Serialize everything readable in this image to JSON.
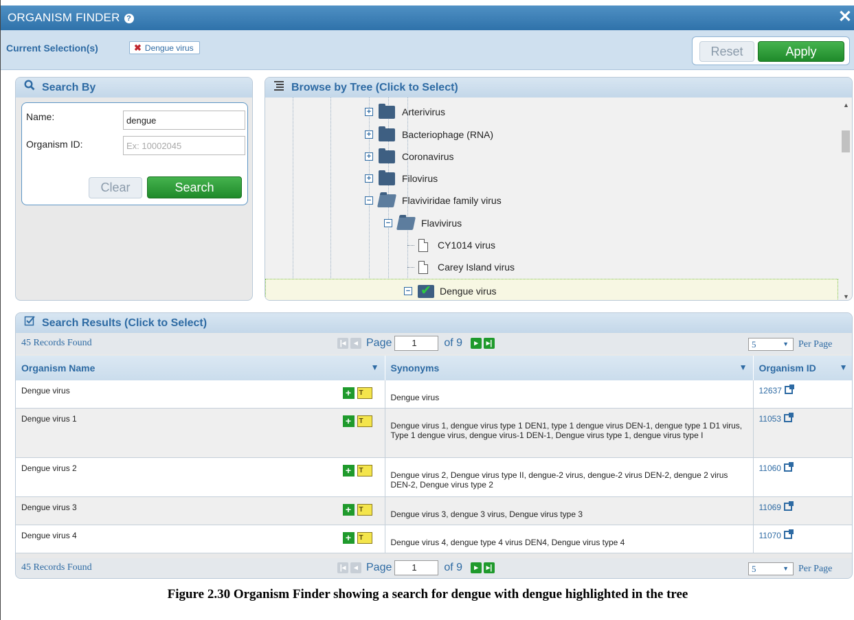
{
  "window": {
    "title": "ORGANISM FINDER",
    "help_icon": "help-icon",
    "close_icon": "close-icon"
  },
  "selection": {
    "label": "Current Selection(s)",
    "chips": [
      "Dengue virus"
    ],
    "reset_label": "Reset",
    "apply_label": "Apply"
  },
  "search_by": {
    "title": "Search By",
    "name_label": "Name:",
    "name_value": "dengue",
    "id_label": "Organism ID:",
    "id_placeholder": "Ex: 10002045",
    "clear_label": "Clear",
    "search_label": "Search"
  },
  "tree": {
    "title": "Browse by Tree (Click to Select)",
    "nodes": [
      {
        "label": "Arterivirus",
        "state": "collapsed",
        "type": "folder"
      },
      {
        "label": "Bacteriophage (RNA)",
        "state": "collapsed",
        "type": "folder"
      },
      {
        "label": "Coronavirus",
        "state": "collapsed",
        "type": "folder"
      },
      {
        "label": "Filovirus",
        "state": "collapsed",
        "type": "folder"
      },
      {
        "label": "Flaviviridae family virus",
        "state": "expanded",
        "type": "folder"
      },
      {
        "label": "Flavivirus",
        "state": "expanded",
        "type": "folder"
      },
      {
        "label": "CY1014 virus",
        "state": "leaf",
        "type": "doc"
      },
      {
        "label": "Carey Island virus",
        "state": "leaf",
        "type": "doc"
      },
      {
        "label": "Dengue virus",
        "state": "expanded",
        "type": "checked-folder",
        "selected": true
      }
    ]
  },
  "results": {
    "title": "Search Results (Click to Select)",
    "records_found": "45 Records Found",
    "page_label": "Page",
    "page_value": "1",
    "of_label": "of 9",
    "per_page_value": "5",
    "per_page_label": "Per Page",
    "columns": [
      "Organism Name",
      "Synonyms",
      "Organism ID"
    ],
    "rows": [
      {
        "name": "Dengue virus",
        "synonyms": "Dengue virus",
        "id": "12637"
      },
      {
        "name": "Dengue virus 1",
        "synonyms": "Dengue virus 1, dengue virus type 1 DEN1, type 1 dengue virus DEN-1, dengue type 1 D1 virus, Type 1 dengue virus, dengue virus-1 DEN-1, Dengue virus type 1, dengue virus type I",
        "id": "11053"
      },
      {
        "name": "Dengue virus 2",
        "synonyms": "Dengue virus 2, Dengue virus type II, dengue-2 virus, dengue-2 virus DEN-2, dengue 2 virus DEN-2, Dengue virus type 2",
        "id": "11060"
      },
      {
        "name": "Dengue virus 3",
        "synonyms": "Dengue virus 3, dengue 3 virus, Dengue virus type 3",
        "id": "11069"
      },
      {
        "name": "Dengue virus 4",
        "synonyms": "Dengue virus 4, dengue type 4 virus DEN4, Dengue virus type 4",
        "id": "11070"
      }
    ]
  },
  "caption": "Figure 2.30  Organism Finder showing a search for dengue with dengue highlighted in the tree"
}
